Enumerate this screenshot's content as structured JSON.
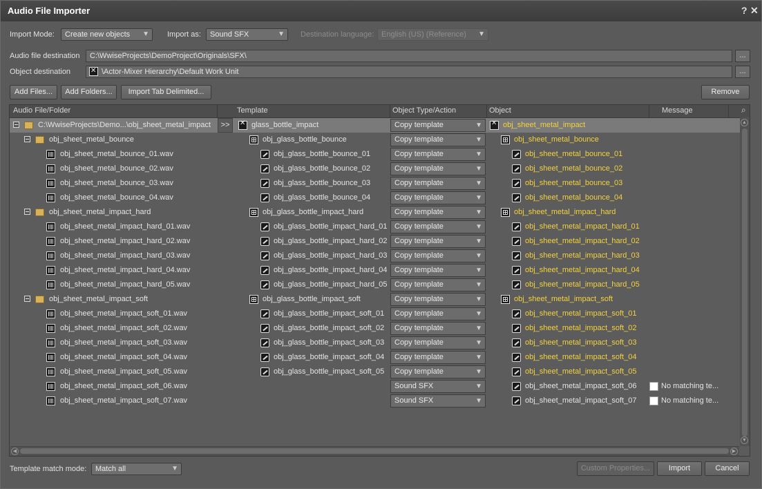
{
  "window": {
    "title": "Audio File Importer",
    "help": "?",
    "close": "✕"
  },
  "toolbar": {
    "import_mode_label": "Import Mode:",
    "import_mode_value": "Create new objects",
    "import_as_label": "Import as:",
    "import_as_value": "Sound SFX",
    "dest_lang_label": "Destination language:",
    "dest_lang_value": "English (US) (Reference)"
  },
  "paths": {
    "audio_dest_label": "Audio file destination",
    "audio_dest_value": "C:\\WwiseProjects\\DemoProject\\Originals\\SFX\\",
    "object_dest_label": "Object destination",
    "object_dest_value": "\\Actor-Mixer Hierarchy\\Default Work Unit",
    "browse": "..."
  },
  "buttons": {
    "add_files": "Add Files...",
    "add_folders": "Add Folders...",
    "import_tab": "Import Tab Delimited...",
    "remove": "Remove",
    "custom_props": "Custom Properties...",
    "import": "Import",
    "cancel": "Cancel"
  },
  "grid": {
    "columns": [
      "Audio File/Folder",
      "Template",
      "Object Type/Action",
      "Object",
      "Message"
    ],
    "root": {
      "file": "C:\\WwiseProjects\\Demo...\\obj_sheet_metal_impact",
      "arrow": ">>",
      "template": "glass_bottle_impact",
      "action": "Copy template",
      "object": "obj_sheet_metal_impact"
    },
    "rows": [
      {
        "file": "obj_sheet_metal_bounce",
        "template": "obj_glass_bottle_bounce",
        "action": "Copy template",
        "object": "obj_sheet_metal_bounce",
        "folder": true
      },
      {
        "file": "obj_sheet_metal_bounce_01.wav",
        "template": "obj_glass_bottle_bounce_01",
        "action": "Copy template",
        "object": "obj_sheet_metal_bounce_01"
      },
      {
        "file": "obj_sheet_metal_bounce_02.wav",
        "template": "obj_glass_bottle_bounce_02",
        "action": "Copy template",
        "object": "obj_sheet_metal_bounce_02"
      },
      {
        "file": "obj_sheet_metal_bounce_03.wav",
        "template": "obj_glass_bottle_bounce_03",
        "action": "Copy template",
        "object": "obj_sheet_metal_bounce_03"
      },
      {
        "file": "obj_sheet_metal_bounce_04.wav",
        "template": "obj_glass_bottle_bounce_04",
        "action": "Copy template",
        "object": "obj_sheet_metal_bounce_04"
      },
      {
        "file": "obj_sheet_metal_impact_hard",
        "template": "obj_glass_bottle_impact_hard",
        "action": "Copy template",
        "object": "obj_sheet_metal_impact_hard",
        "folder": true
      },
      {
        "file": "obj_sheet_metal_impact_hard_01.wav",
        "template": "obj_glass_bottle_impact_hard_01",
        "action": "Copy template",
        "object": "obj_sheet_metal_impact_hard_01"
      },
      {
        "file": "obj_sheet_metal_impact_hard_02.wav",
        "template": "obj_glass_bottle_impact_hard_02",
        "action": "Copy template",
        "object": "obj_sheet_metal_impact_hard_02"
      },
      {
        "file": "obj_sheet_metal_impact_hard_03.wav",
        "template": "obj_glass_bottle_impact_hard_03",
        "action": "Copy template",
        "object": "obj_sheet_metal_impact_hard_03"
      },
      {
        "file": "obj_sheet_metal_impact_hard_04.wav",
        "template": "obj_glass_bottle_impact_hard_04",
        "action": "Copy template",
        "object": "obj_sheet_metal_impact_hard_04"
      },
      {
        "file": "obj_sheet_metal_impact_hard_05.wav",
        "template": "obj_glass_bottle_impact_hard_05",
        "action": "Copy template",
        "object": "obj_sheet_metal_impact_hard_05"
      },
      {
        "file": "obj_sheet_metal_impact_soft",
        "template": "obj_glass_bottle_impact_soft",
        "action": "Copy template",
        "object": "obj_sheet_metal_impact_soft",
        "folder": true
      },
      {
        "file": "obj_sheet_metal_impact_soft_01.wav",
        "template": "obj_glass_bottle_impact_soft_01",
        "action": "Copy template",
        "object": "obj_sheet_metal_impact_soft_01"
      },
      {
        "file": "obj_sheet_metal_impact_soft_02.wav",
        "template": "obj_glass_bottle_impact_soft_02",
        "action": "Copy template",
        "object": "obj_sheet_metal_impact_soft_02"
      },
      {
        "file": "obj_sheet_metal_impact_soft_03.wav",
        "template": "obj_glass_bottle_impact_soft_03",
        "action": "Copy template",
        "object": "obj_sheet_metal_impact_soft_03"
      },
      {
        "file": "obj_sheet_metal_impact_soft_04.wav",
        "template": "obj_glass_bottle_impact_soft_04",
        "action": "Copy template",
        "object": "obj_sheet_metal_impact_soft_04"
      },
      {
        "file": "obj_sheet_metal_impact_soft_05.wav",
        "template": "obj_glass_bottle_impact_soft_05",
        "action": "Copy template",
        "object": "obj_sheet_metal_impact_soft_05"
      },
      {
        "file": "obj_sheet_metal_impact_soft_06.wav",
        "template": "",
        "action": "Sound SFX",
        "object": "obj_sheet_metal_impact_soft_06",
        "message": "No matching te..."
      },
      {
        "file": "obj_sheet_metal_impact_soft_07.wav",
        "template": "",
        "action": "Sound SFX",
        "object": "obj_sheet_metal_impact_soft_07",
        "message": "No matching te..."
      }
    ]
  },
  "footer": {
    "match_label": "Template match mode:",
    "match_value": "Match all"
  },
  "icons": {
    "folder": "folder-icon",
    "wav": "waveform-icon",
    "random": "random-container-icon",
    "sound": "sound-sfx-icon",
    "actor": "actor-mixer-icon",
    "dropdown": "chevron-down-icon"
  },
  "colors": {
    "object_text": "#f3d23f",
    "selected_row": "#7a7a7a",
    "panel": "#5a5a5a"
  }
}
